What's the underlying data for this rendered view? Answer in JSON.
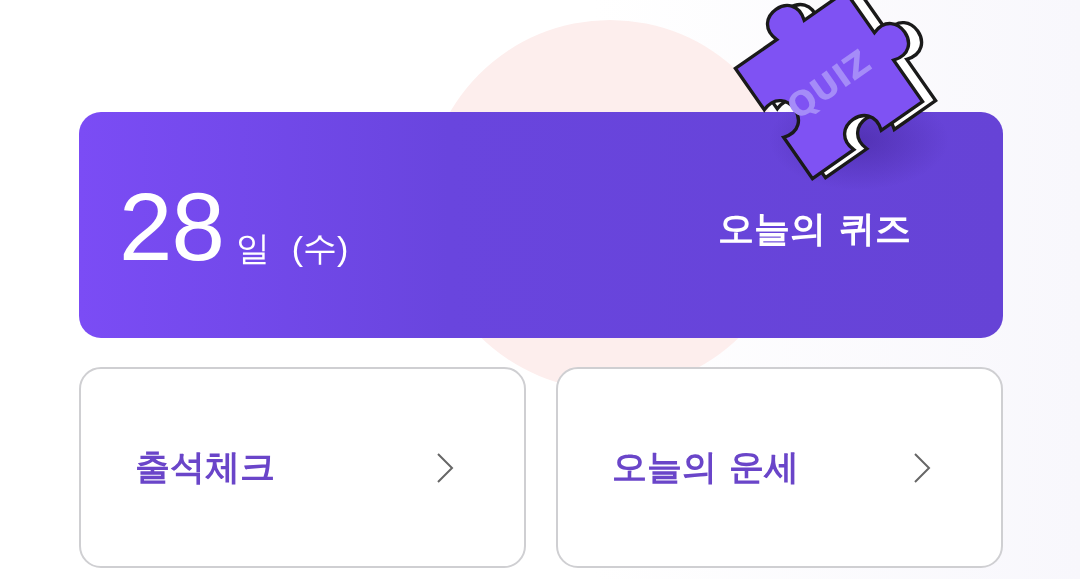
{
  "quiz_banner": {
    "day": "28",
    "day_unit": "일",
    "weekday": "(수)",
    "title": "오늘의 퀴즈",
    "puzzle_label": "QUIZ"
  },
  "cards": [
    {
      "label": "출석체크"
    },
    {
      "label": "오늘의 운세"
    }
  ]
}
